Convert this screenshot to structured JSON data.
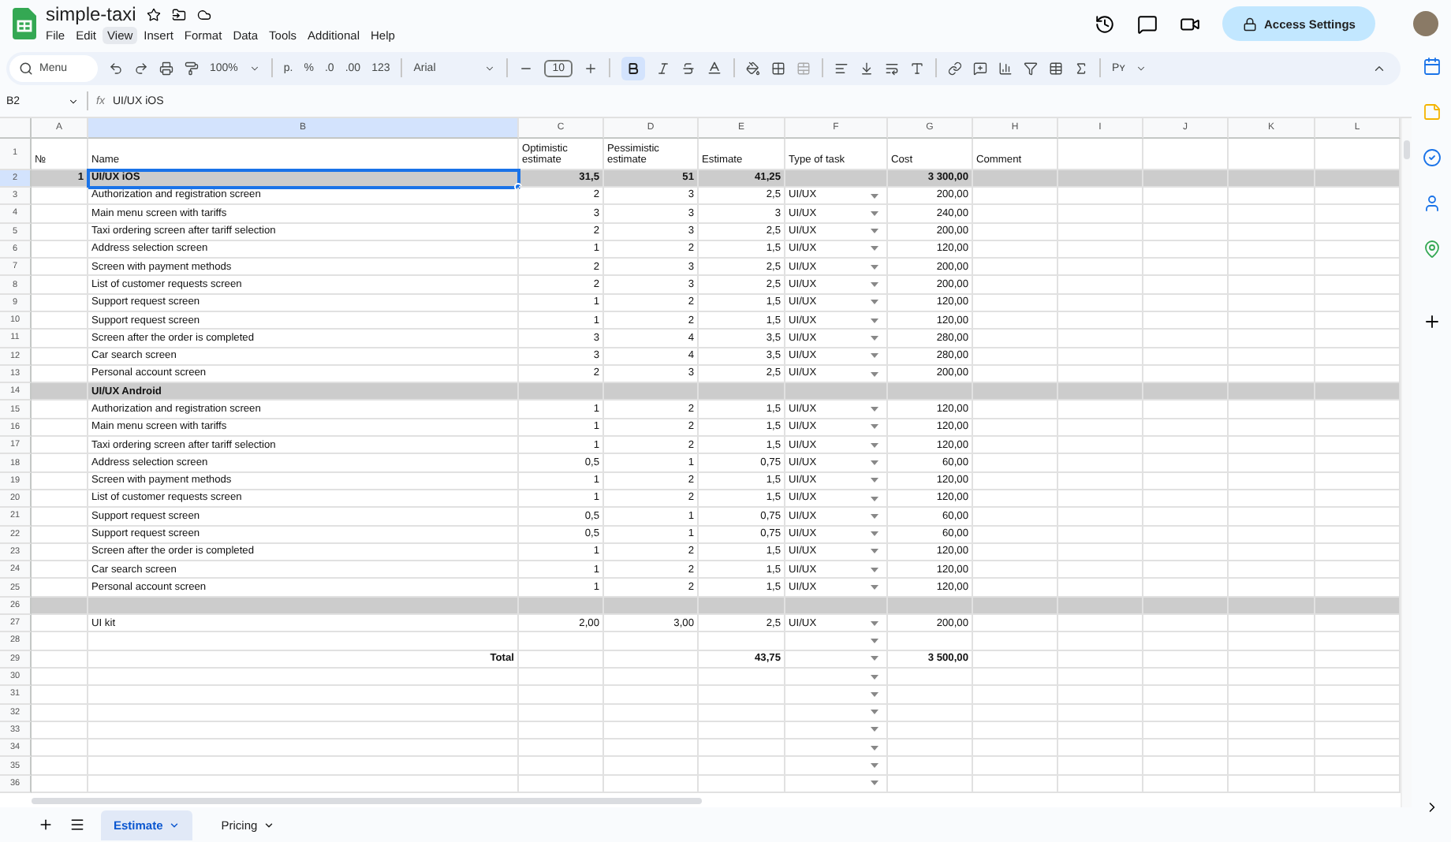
{
  "document": {
    "title": "simple-taxi"
  },
  "menu": [
    {
      "label": "File",
      "selected": false
    },
    {
      "label": "Edit",
      "selected": false
    },
    {
      "label": "View",
      "selected": true
    },
    {
      "label": "Insert",
      "selected": false
    },
    {
      "label": "Format",
      "selected": false
    },
    {
      "label": "Data",
      "selected": false
    },
    {
      "label": "Tools",
      "selected": false
    },
    {
      "label": "Additional",
      "selected": false
    },
    {
      "label": "Help",
      "selected": false
    }
  ],
  "share_button": "Access Settings",
  "toolbar": {
    "search_placeholder": "Menu",
    "zoom": "100%",
    "currency": "р.",
    "percent": "%",
    "decrease_decimals": ".0",
    "increase_decimals": ".00",
    "number_format": "123",
    "font": "Arial",
    "font_size": "10",
    "bold_active": true,
    "input_tools": "Pʏ"
  },
  "formula_bar": {
    "cell": "B2",
    "fx": "fx",
    "value": "UI/UX iOS"
  },
  "columns": [
    {
      "label": "A",
      "selected": false
    },
    {
      "label": "B",
      "selected": true
    },
    {
      "label": "C",
      "selected": false
    },
    {
      "label": "D",
      "selected": false
    },
    {
      "label": "E",
      "selected": false
    },
    {
      "label": "F",
      "selected": false
    },
    {
      "label": "G",
      "selected": false
    },
    {
      "label": "H",
      "selected": false
    },
    {
      "label": "I",
      "selected": false
    },
    {
      "label": "J",
      "selected": false
    },
    {
      "label": "K",
      "selected": false
    },
    {
      "label": "L",
      "selected": false
    }
  ],
  "rows": [
    {
      "num": "1",
      "kind": "header",
      "selected": false,
      "dropdown": false,
      "cells": {
        "a": "№",
        "b": "Name",
        "c": "Optimistic estimate",
        "d": "Pessimistic estimate",
        "e": "Estimate",
        "f": "Type of task",
        "g": "Cost",
        "h": "Comment"
      }
    },
    {
      "num": "2",
      "kind": "group",
      "selected": true,
      "dropdown": false,
      "cells": {
        "a": "1",
        "b": "UI/UX iOS",
        "c": "31,5",
        "d": "51",
        "e": "41,25",
        "g": "3 300,00"
      }
    },
    {
      "num": "3",
      "kind": "item",
      "selected": false,
      "dropdown": true,
      "cells": {
        "b": "Authorization and registration screen",
        "c": "2",
        "d": "3",
        "e": "2,5",
        "f": "UI/UX",
        "g": "200,00"
      }
    },
    {
      "num": "4",
      "kind": "item",
      "selected": false,
      "dropdown": true,
      "cells": {
        "b": "Main menu screen with tariffs",
        "c": "3",
        "d": "3",
        "e": "3",
        "f": "UI/UX",
        "g": "240,00"
      }
    },
    {
      "num": "5",
      "kind": "item",
      "selected": false,
      "dropdown": true,
      "cells": {
        "b": "Taxi ordering screen after tariff selection",
        "c": "2",
        "d": "3",
        "e": "2,5",
        "f": "UI/UX",
        "g": "200,00"
      }
    },
    {
      "num": "6",
      "kind": "item",
      "selected": false,
      "dropdown": true,
      "cells": {
        "b": "Address selection screen",
        "c": "1",
        "d": "2",
        "e": "1,5",
        "f": "UI/UX",
        "g": "120,00"
      }
    },
    {
      "num": "7",
      "kind": "item",
      "selected": false,
      "dropdown": true,
      "cells": {
        "b": "Screen with payment methods",
        "c": "2",
        "d": "3",
        "e": "2,5",
        "f": "UI/UX",
        "g": "200,00"
      }
    },
    {
      "num": "8",
      "kind": "item",
      "selected": false,
      "dropdown": true,
      "cells": {
        "b": "List of customer requests screen",
        "c": "2",
        "d": "3",
        "e": "2,5",
        "f": "UI/UX",
        "g": "200,00"
      }
    },
    {
      "num": "9",
      "kind": "item",
      "selected": false,
      "dropdown": true,
      "cells": {
        "b": "Support request screen",
        "c": "1",
        "d": "2",
        "e": "1,5",
        "f": "UI/UX",
        "g": "120,00"
      }
    },
    {
      "num": "10",
      "kind": "item",
      "selected": false,
      "dropdown": true,
      "cells": {
        "b": "Support request screen",
        "c": "1",
        "d": "2",
        "e": "1,5",
        "f": "UI/UX",
        "g": "120,00"
      }
    },
    {
      "num": "11",
      "kind": "item",
      "selected": false,
      "dropdown": true,
      "cells": {
        "b": "Screen after the order is completed",
        "c": "3",
        "d": "4",
        "e": "3,5",
        "f": "UI/UX",
        "g": "280,00"
      }
    },
    {
      "num": "12",
      "kind": "item",
      "selected": false,
      "dropdown": true,
      "cells": {
        "b": "Car search screen",
        "c": "3",
        "d": "4",
        "e": "3,5",
        "f": "UI/UX",
        "g": "280,00"
      }
    },
    {
      "num": "13",
      "kind": "item",
      "selected": false,
      "dropdown": true,
      "cells": {
        "b": "Personal account screen",
        "c": "2",
        "d": "3",
        "e": "2,5",
        "f": "UI/UX",
        "g": "200,00"
      }
    },
    {
      "num": "14",
      "kind": "group",
      "selected": false,
      "dropdown": false,
      "cells": {
        "b": "UI/UX Android"
      }
    },
    {
      "num": "15",
      "kind": "item",
      "selected": false,
      "dropdown": true,
      "cells": {
        "b": "Authorization and registration screen",
        "c": "1",
        "d": "2",
        "e": "1,5",
        "f": "UI/UX",
        "g": "120,00"
      }
    },
    {
      "num": "16",
      "kind": "item",
      "selected": false,
      "dropdown": true,
      "cells": {
        "b": "Main menu screen with tariffs",
        "c": "1",
        "d": "2",
        "e": "1,5",
        "f": "UI/UX",
        "g": "120,00"
      }
    },
    {
      "num": "17",
      "kind": "item",
      "selected": false,
      "dropdown": true,
      "cells": {
        "b": "Taxi ordering screen after tariff selection",
        "c": "1",
        "d": "2",
        "e": "1,5",
        "f": "UI/UX",
        "g": "120,00"
      }
    },
    {
      "num": "18",
      "kind": "item",
      "selected": false,
      "dropdown": true,
      "cells": {
        "b": "Address selection screen",
        "c": "0,5",
        "d": "1",
        "e": "0,75",
        "f": "UI/UX",
        "g": "60,00"
      }
    },
    {
      "num": "19",
      "kind": "item",
      "selected": false,
      "dropdown": true,
      "cells": {
        "b": "Screen with payment methods",
        "c": "1",
        "d": "2",
        "e": "1,5",
        "f": "UI/UX",
        "g": "120,00"
      }
    },
    {
      "num": "20",
      "kind": "item",
      "selected": false,
      "dropdown": true,
      "cells": {
        "b": "List of customer requests screen",
        "c": "1",
        "d": "2",
        "e": "1,5",
        "f": "UI/UX",
        "g": "120,00"
      }
    },
    {
      "num": "21",
      "kind": "item",
      "selected": false,
      "dropdown": true,
      "cells": {
        "b": "Support request screen",
        "c": "0,5",
        "d": "1",
        "e": "0,75",
        "f": "UI/UX",
        "g": "60,00"
      }
    },
    {
      "num": "22",
      "kind": "item",
      "selected": false,
      "dropdown": true,
      "cells": {
        "b": "Support request screen",
        "c": "0,5",
        "d": "1",
        "e": "0,75",
        "f": "UI/UX",
        "g": "60,00"
      }
    },
    {
      "num": "23",
      "kind": "item",
      "selected": false,
      "dropdown": true,
      "cells": {
        "b": "Screen after the order is completed",
        "c": "1",
        "d": "2",
        "e": "1,5",
        "f": "UI/UX",
        "g": "120,00"
      }
    },
    {
      "num": "24",
      "kind": "item",
      "selected": false,
      "dropdown": true,
      "cells": {
        "b": "Car search screen",
        "c": "1",
        "d": "2",
        "e": "1,5",
        "f": "UI/UX",
        "g": "120,00"
      }
    },
    {
      "num": "25",
      "kind": "item",
      "selected": false,
      "dropdown": true,
      "cells": {
        "b": "Personal account screen",
        "c": "1",
        "d": "2",
        "e": "1,5",
        "f": "UI/UX",
        "g": "120,00"
      }
    },
    {
      "num": "26",
      "kind": "group",
      "selected": false,
      "dropdown": false,
      "cells": {}
    },
    {
      "num": "27",
      "kind": "item",
      "selected": false,
      "dropdown": true,
      "cells": {
        "b": "UI kit",
        "c": "2,00",
        "d": "3,00",
        "e": "2,5",
        "f": "UI/UX",
        "g": "200,00"
      }
    },
    {
      "num": "28",
      "kind": "item",
      "selected": false,
      "dropdown": true,
      "cells": {}
    },
    {
      "num": "29",
      "kind": "total",
      "selected": false,
      "dropdown": true,
      "cells": {
        "b": "Total",
        "e": "43,75",
        "g": "3 500,00"
      }
    },
    {
      "num": "30",
      "kind": "item",
      "selected": false,
      "dropdown": true,
      "cells": {}
    },
    {
      "num": "31",
      "kind": "item",
      "selected": false,
      "dropdown": true,
      "cells": {}
    },
    {
      "num": "32",
      "kind": "item",
      "selected": false,
      "dropdown": true,
      "cells": {}
    },
    {
      "num": "33",
      "kind": "item",
      "selected": false,
      "dropdown": true,
      "cells": {}
    },
    {
      "num": "34",
      "kind": "item",
      "selected": false,
      "dropdown": true,
      "cells": {}
    },
    {
      "num": "35",
      "kind": "item",
      "selected": false,
      "dropdown": true,
      "cells": {}
    },
    {
      "num": "36",
      "kind": "item",
      "selected": false,
      "dropdown": true,
      "cells": {}
    }
  ],
  "sheets": [
    {
      "label": "Estimate",
      "selected": true
    },
    {
      "label": "Pricing",
      "selected": false
    }
  ]
}
